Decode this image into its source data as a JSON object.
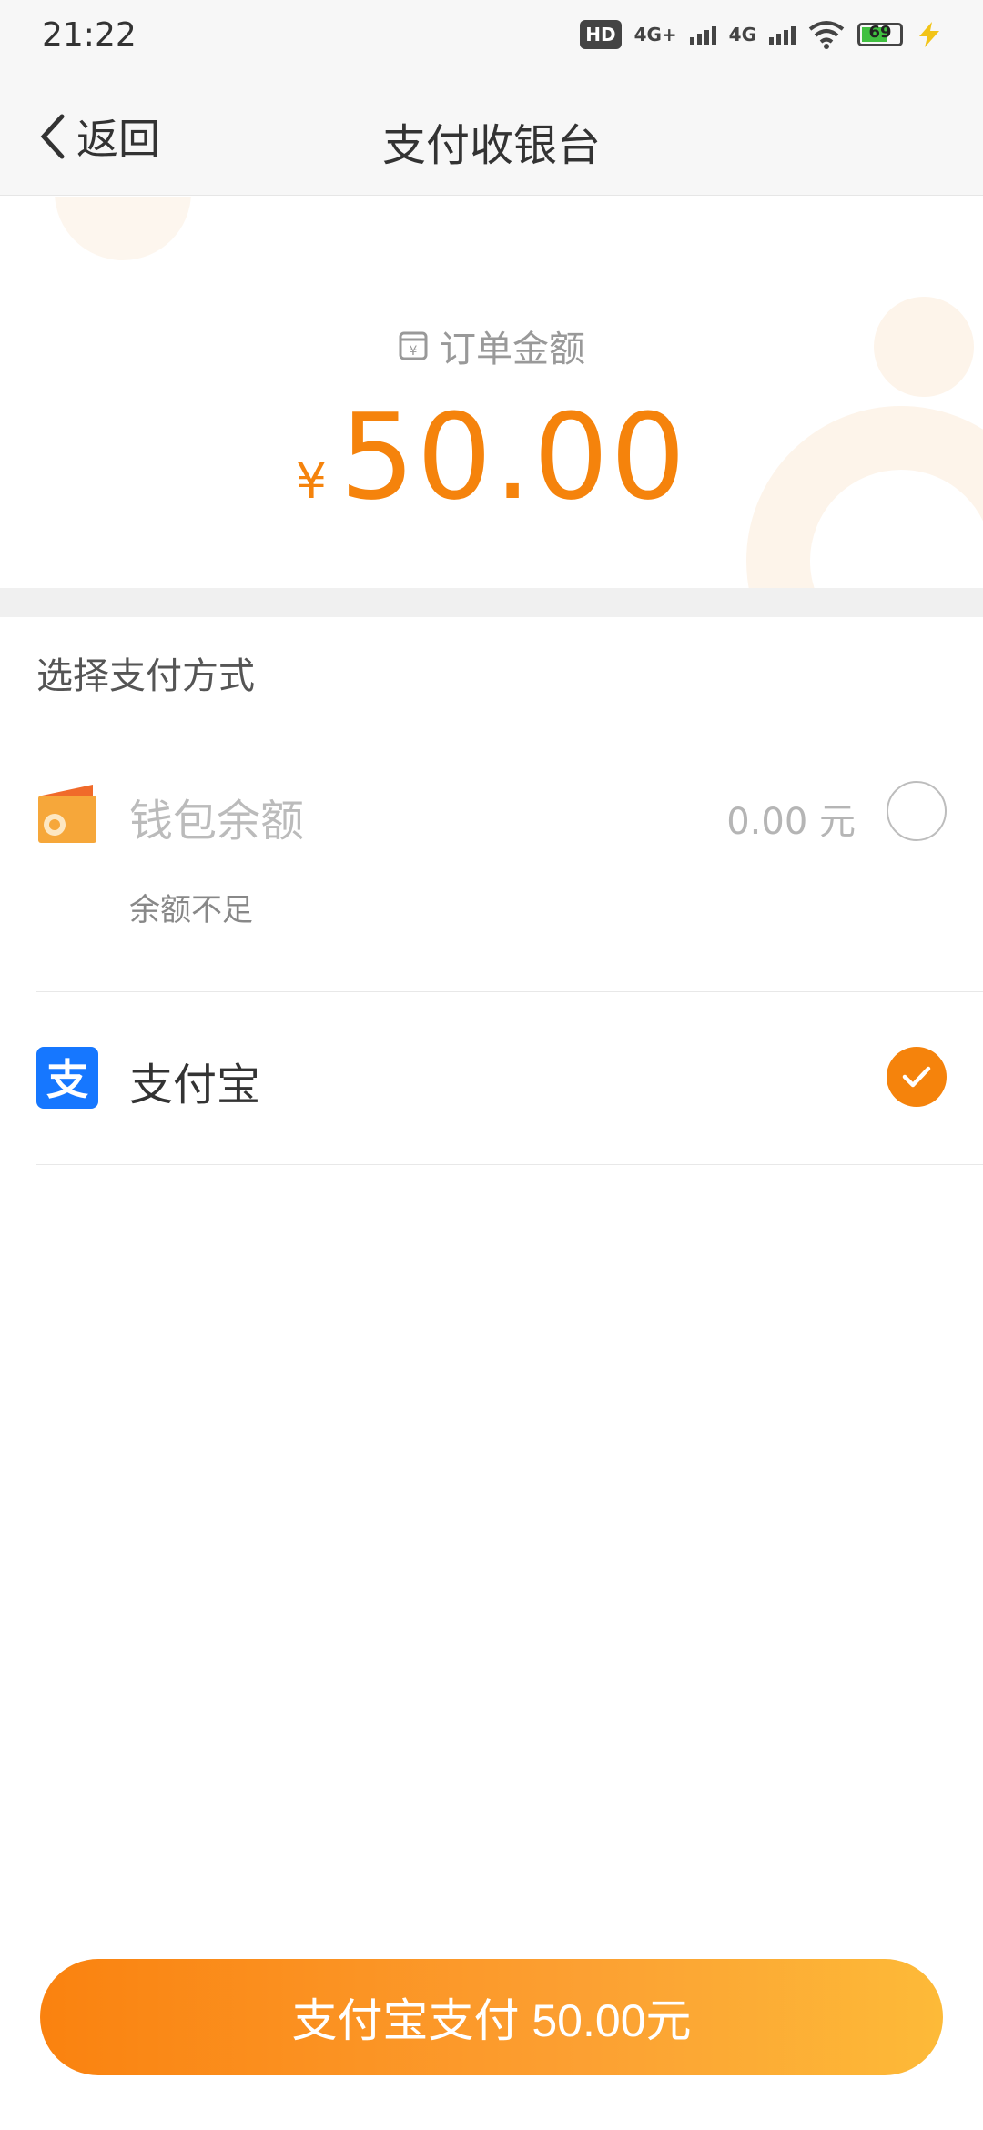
{
  "status_bar": {
    "time": "21:22",
    "hd_label": "HD",
    "network_1": "4G+",
    "network_2": "4G",
    "battery_level": "69"
  },
  "header": {
    "back_label": "返回",
    "title": "支付收银台"
  },
  "order": {
    "label": "订单金额",
    "currency_symbol": "¥",
    "amount": "50.00"
  },
  "payment": {
    "section_title": "选择支付方式",
    "methods": [
      {
        "name": "钱包余额",
        "amount_text": "0.00 元",
        "note": "余额不足",
        "selected": false,
        "disabled": true,
        "icon": "wallet-icon"
      },
      {
        "name": "支付宝",
        "selected": true,
        "icon": "alipay-icon"
      }
    ]
  },
  "pay_button": {
    "label": "支付宝支付 50.00元"
  },
  "colors": {
    "accent": "#f5830c",
    "alipay_blue": "#1677ff",
    "disabled_text": "#bbbbbb"
  }
}
